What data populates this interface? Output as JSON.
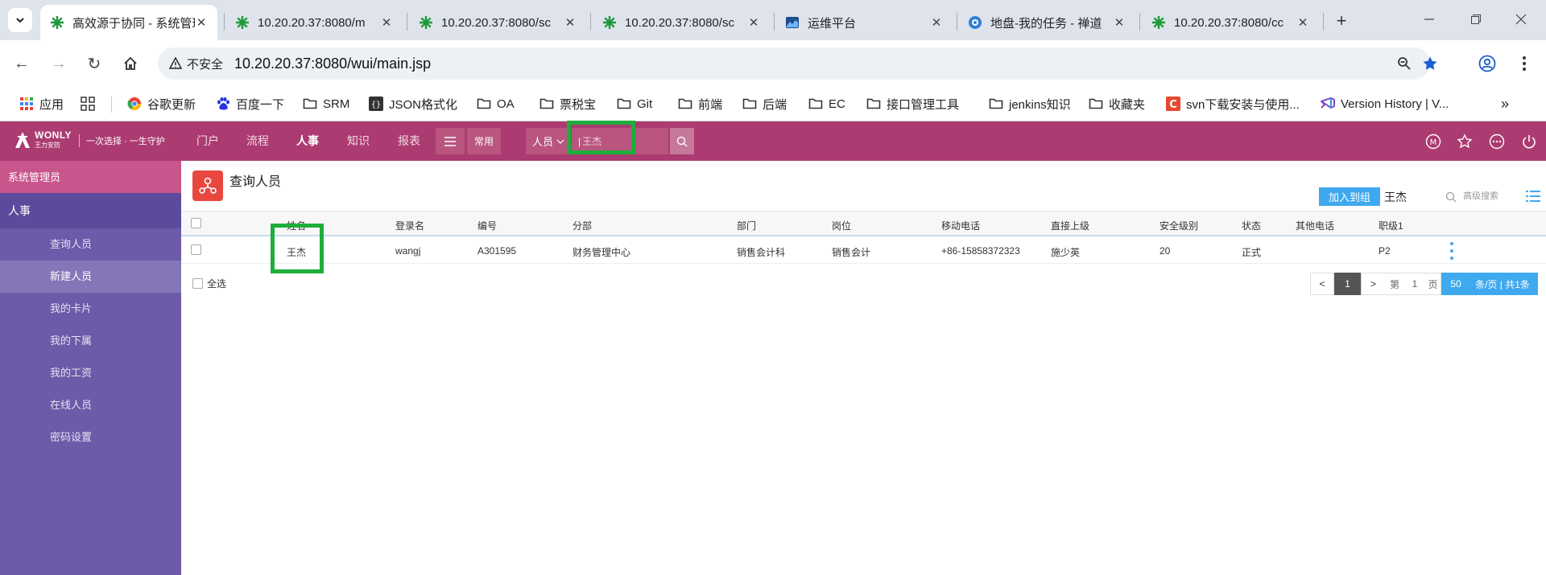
{
  "browser": {
    "tabs": [
      {
        "title": "高效源于协同 - 系统管理员",
        "icon": "green-gear-icon",
        "active": true
      },
      {
        "title": "10.20.20.37:8080/m",
        "icon": "green-gear-icon"
      },
      {
        "title": "10.20.20.37:8080/sc",
        "icon": "green-gear-icon"
      },
      {
        "title": "10.20.20.37:8080/sc",
        "icon": "green-gear-icon"
      },
      {
        "title": "运维平台",
        "icon": "chart-icon"
      },
      {
        "title": "地盘-我的任务 - 禅道",
        "icon": "zentao-icon"
      },
      {
        "title": "10.20.20.37:8080/cc",
        "icon": "green-gear-icon"
      }
    ],
    "address": {
      "security_label": "不安全",
      "url": "10.20.20.37:8080/wui/main.jsp"
    },
    "bookmarks": [
      {
        "label": "应用",
        "icon": "apps-grid-icon"
      },
      {
        "label": "谷歌更新",
        "icon": "chrome-icon"
      },
      {
        "label": "百度一下",
        "icon": "baidu-paw-icon"
      },
      {
        "label": "SRM",
        "icon": "folder-icon"
      },
      {
        "label": "JSON格式化",
        "icon": "json-icon"
      },
      {
        "label": "OA",
        "icon": "folder-icon"
      },
      {
        "label": "票税宝",
        "icon": "folder-icon"
      },
      {
        "label": "Git",
        "icon": "folder-icon"
      },
      {
        "label": "前端",
        "icon": "folder-icon"
      },
      {
        "label": "后端",
        "icon": "folder-icon"
      },
      {
        "label": "EC",
        "icon": "folder-icon"
      },
      {
        "label": "接口管理工具",
        "icon": "folder-icon"
      },
      {
        "label": "jenkins知识",
        "icon": "folder-icon"
      },
      {
        "label": "收藏夹",
        "icon": "folder-icon"
      },
      {
        "label": "svn下载安装与使用...",
        "icon": "red-c-icon"
      },
      {
        "label": "Version History | V...",
        "icon": "vs-icon"
      }
    ]
  },
  "app": {
    "logo_text": "WONLY",
    "logo_sub": "王力安防",
    "slogan": "一次选择 · 一生守护",
    "nav": [
      "门户",
      "流程",
      "人事",
      "知识",
      "报表"
    ],
    "active_nav": "人事",
    "common_label": "常用",
    "search_type": "人员",
    "search_value": "王杰",
    "colors": {
      "header": "#ab3b70",
      "sidebar": "#6d5aa8",
      "highlight": "#1fad3b",
      "accent": "#3fa9ef"
    }
  },
  "sidebar": {
    "admin_label": "系统管理员",
    "group_label": "人事",
    "items": [
      {
        "label": "查询人员"
      },
      {
        "label": "新建人员",
        "active": true
      },
      {
        "label": "我的卡片"
      },
      {
        "label": "我的下属"
      },
      {
        "label": "我的工资"
      },
      {
        "label": "在线人员"
      },
      {
        "label": "密码设置"
      }
    ]
  },
  "main": {
    "title": "查询人员",
    "add_group_label": "加入到组",
    "filter_value": "王杰",
    "advanced_search_label": "高级搜索",
    "columns": [
      "姓名",
      "登录名",
      "编号",
      "分部",
      "部门",
      "岗位",
      "移动电话",
      "直接上级",
      "安全级别",
      "状态",
      "其他电话",
      "职级1"
    ],
    "rows": [
      {
        "name": "王杰",
        "login": "wangj",
        "code": "A301595",
        "branch": "财务管理中心",
        "dept": "销售会计科",
        "post": "销售会计",
        "mobile": "+86-15858372323",
        "manager": "施少英",
        "security": "20",
        "status": "正式",
        "other_phone": "",
        "rank": "P2"
      }
    ],
    "select_all_label": "全选",
    "pager": {
      "prev": "<",
      "current": "1",
      "next": ">",
      "page_prefix": "第",
      "page_num": "1",
      "page_suffix": "页",
      "page_size": "50",
      "summary": "条/页 | 共1条"
    }
  }
}
